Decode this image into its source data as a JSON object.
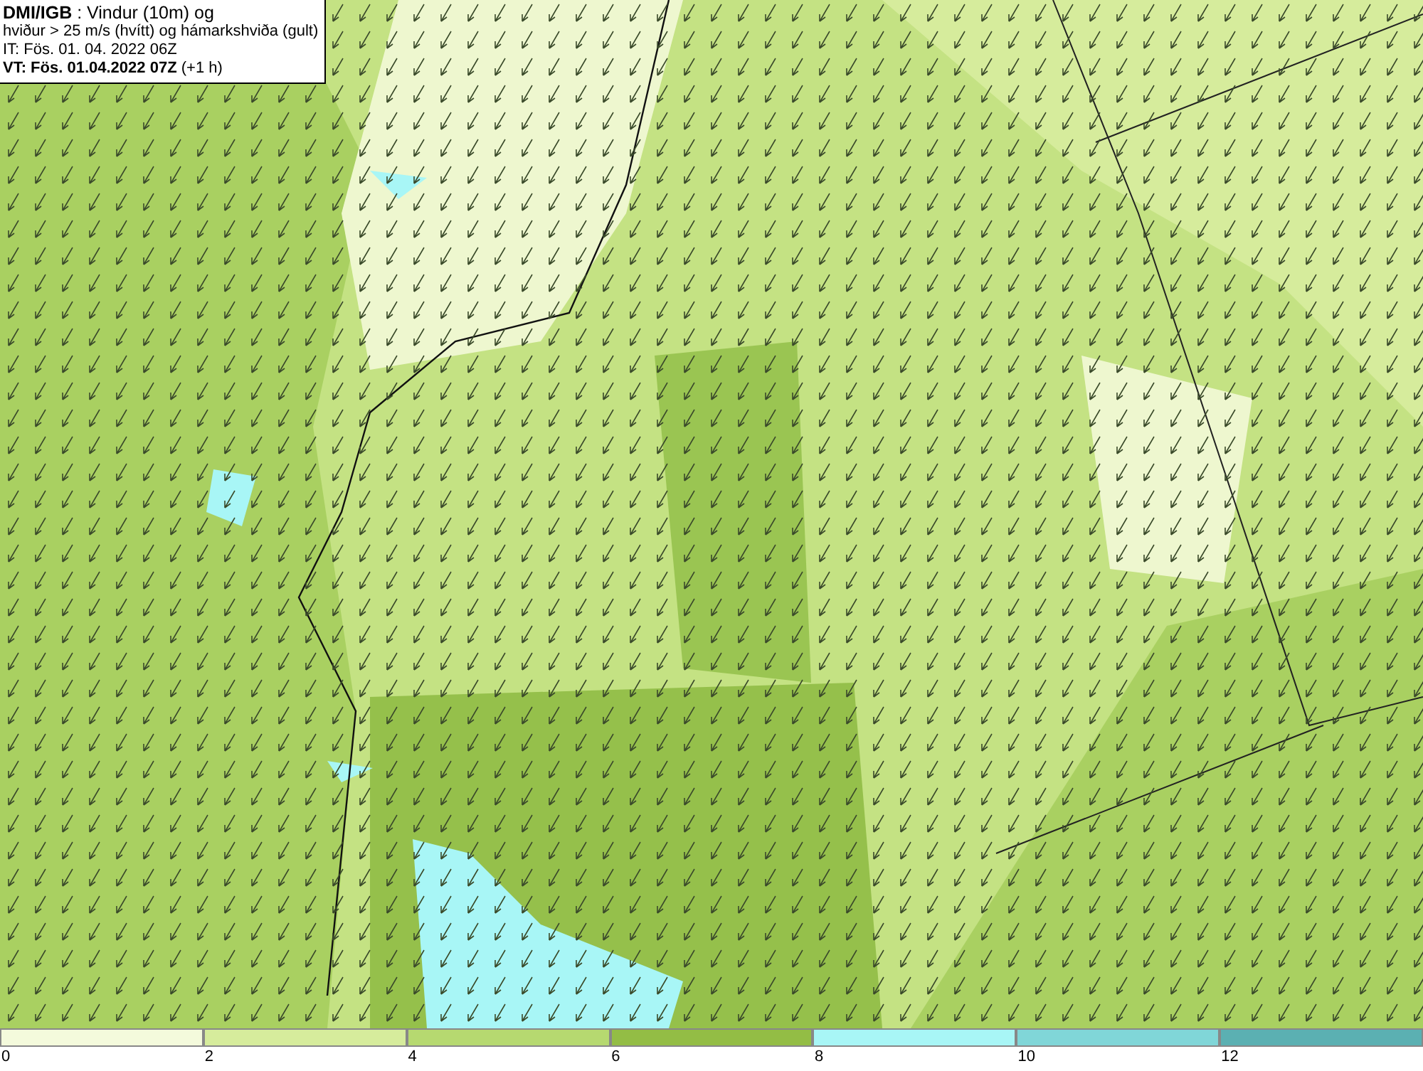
{
  "header": {
    "lines": [
      "**DMI/IGB** : Vindur (10m) og",
      "hviður > 25 m/s (hvítt) og hámarkshviða (gult)",
      "IT: Fös. 01. 04. 2022 06Z",
      "**VT: Fös. 01.04.2022 07Z** (+1 h)"
    ]
  },
  "legend": [
    {
      "label": "0",
      "color": "#f4fadc"
    },
    {
      "label": "2",
      "color": "#d6ec9c"
    },
    {
      "label": "4",
      "color": "#b6d970"
    },
    {
      "label": "6",
      "color": "#93bd45"
    },
    {
      "label": "8",
      "color": "#a8f6f6"
    },
    {
      "label": "10",
      "color": "#80d6d8"
    },
    {
      "label": "12",
      "color": "#5bb0b2"
    }
  ]
}
